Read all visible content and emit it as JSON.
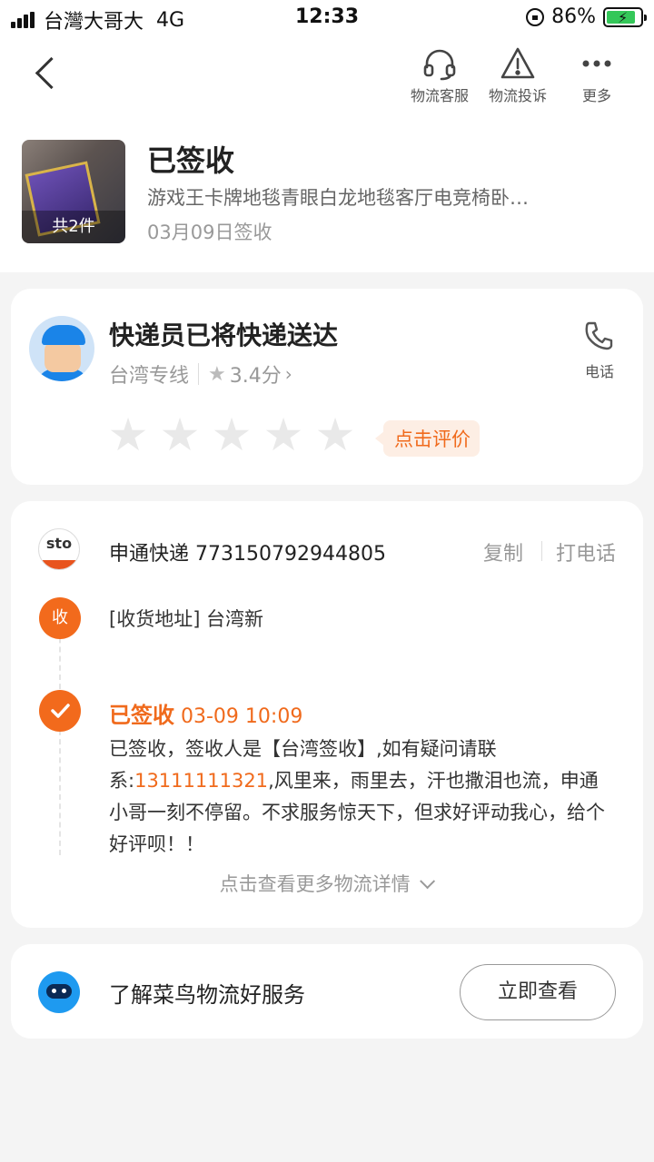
{
  "status_bar": {
    "carrier": "台灣大哥大",
    "network": "4G",
    "time": "12:33",
    "battery": "86%"
  },
  "header": {
    "actions": [
      {
        "label": "物流客服",
        "icon": "headset-icon"
      },
      {
        "label": "物流投诉",
        "icon": "warning-icon"
      },
      {
        "label": "更多",
        "icon": "more-icon"
      }
    ]
  },
  "order": {
    "item_count": "共2件",
    "status": "已签收",
    "product_name": "游戏王卡牌地毯青眼白龙地毯客厅电竞椅卧…",
    "sign_date": "03月09日签收"
  },
  "courier": {
    "title": "快递员已将快递送达",
    "line": "台湾专线",
    "rating": "3.4分",
    "phone_label": "电话",
    "rate_prompt": "点击评价",
    "stars_filled": 0,
    "stars_total": 5
  },
  "tracking": {
    "carrier": "申通快递",
    "tracking_number": "773150792944805",
    "copy_label": "复制",
    "call_label": "打电话",
    "receive_node": "收",
    "address": "[收货地址] 台湾新",
    "signed_status": "已签收",
    "signed_time": "03-09 10:09",
    "signed_desc_1": "已签收，签收人是【台湾签收】,如有疑问请联系:",
    "signed_phone": "13111111321",
    "signed_desc_2": ",风里来，雨里去，汗也撒泪也流，申通小哥一刻不停留。不求服务惊天下，但求好评动我心，给个好评呗！！",
    "more_label": "点击查看更多物流详情"
  },
  "service": {
    "text": "了解菜鸟物流好服务",
    "button": "立即查看"
  },
  "colors": {
    "accent": "#f06a1c",
    "background": "#f4f4f4",
    "card": "#ffffff"
  }
}
